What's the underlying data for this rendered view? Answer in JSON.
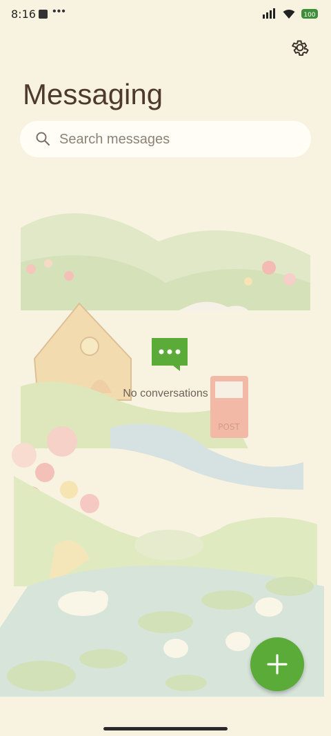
{
  "status_bar": {
    "time": "8:16",
    "dots": "•••",
    "battery_label": "100"
  },
  "header": {
    "title": "Messaging"
  },
  "search": {
    "placeholder": "Search messages"
  },
  "empty_state": {
    "text": "No conversations"
  },
  "illustration": {
    "mailbox_label": "POST"
  },
  "colors": {
    "background": "#f8f3e0",
    "accent": "#5aab38",
    "title": "#4d3a2c"
  }
}
